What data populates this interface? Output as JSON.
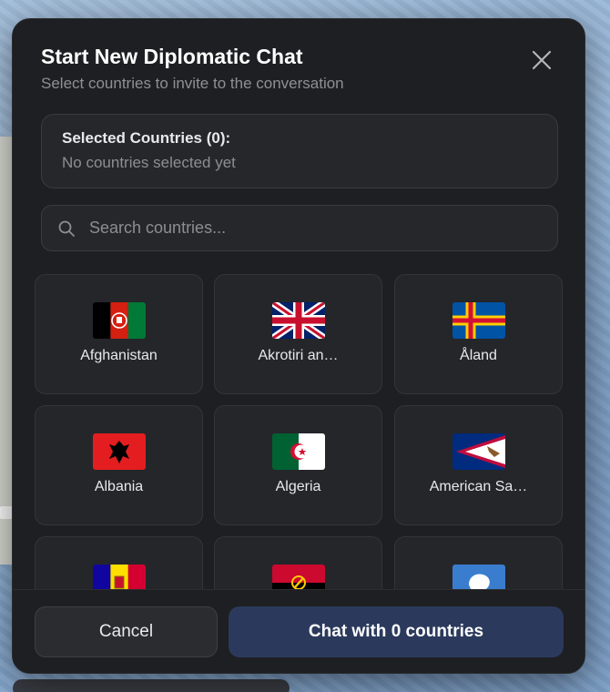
{
  "modal": {
    "title": "Start New Diplomatic Chat",
    "subtitle": "Select countries to invite to the conversation"
  },
  "selected": {
    "heading": "Selected Countries (0):",
    "empty_text": "No countries selected yet"
  },
  "search": {
    "placeholder": "Search countries...",
    "value": ""
  },
  "countries": [
    {
      "name": "Afghanistan",
      "flag": "afghanistan-flag-icon"
    },
    {
      "name": "Akrotiri an…",
      "flag": "uk-flag-icon"
    },
    {
      "name": "Åland",
      "flag": "aland-flag-icon"
    },
    {
      "name": "Albania",
      "flag": "albania-flag-icon"
    },
    {
      "name": "Algeria",
      "flag": "algeria-flag-icon"
    },
    {
      "name": "American Sa…",
      "flag": "american-samoa-flag-icon"
    },
    {
      "name": "",
      "flag": "andorra-flag-icon"
    },
    {
      "name": "",
      "flag": "angola-flag-icon"
    },
    {
      "name": "",
      "flag": "antarctica-flag-icon"
    }
  ],
  "footer": {
    "cancel_label": "Cancel",
    "chat_label": "Chat with 0 countries"
  },
  "colors": {
    "modal_bg": "#1e1f22",
    "card_bg": "#25262a",
    "primary_button": "#2b3a5c"
  }
}
